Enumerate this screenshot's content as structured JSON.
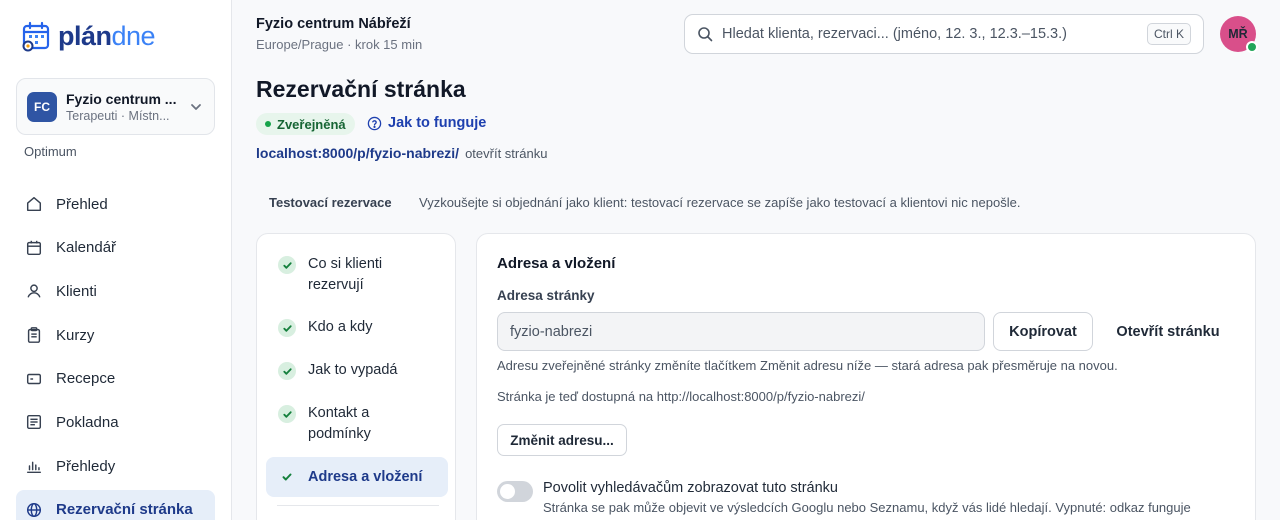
{
  "app": {
    "logo_part1": "plán",
    "logo_part2": "dne"
  },
  "org": {
    "initials": "FC",
    "name": "Fyzio centrum ...",
    "subtitle": "Terapeuti · Místn..."
  },
  "plan": "Optimum",
  "nav": [
    {
      "label": "Přehled",
      "icon": "home-icon"
    },
    {
      "label": "Kalendář",
      "icon": "calendar-icon"
    },
    {
      "label": "Klienti",
      "icon": "user-icon"
    },
    {
      "label": "Kurzy",
      "icon": "clipboard-icon"
    },
    {
      "label": "Recepce",
      "icon": "card-icon"
    },
    {
      "label": "Pokladna",
      "icon": "register-icon"
    },
    {
      "label": "Přehledy",
      "icon": "bar-chart-icon"
    },
    {
      "label": "Rezervační stránka",
      "icon": "globe-icon",
      "active": true
    }
  ],
  "header": {
    "clinic_name": "Fyzio centrum Nábřeží",
    "clinic_sub": "Europe/Prague · krok 15 min",
    "search_placeholder": "Hledat klienta, rezervaci... (jméno, 12. 3., 12.3.–15.3.)",
    "search_shortcut": "Ctrl K",
    "user_initials": "MŘ"
  },
  "page": {
    "title": "Rezervační stránka",
    "status_badge": "Zveřejněná",
    "howto_label": "Jak to funguje",
    "url": "localhost:8000/p/fyzio-nabrezi/",
    "open_page_label": "otevřít stránku",
    "test_label": "Testovací rezervace",
    "test_desc": "Vyzkoušejte si objednání jako klient: testovací rezervace se zapíše jako testovací a klientovi nic nepošle."
  },
  "steps": [
    {
      "label_line1": "Co si klienti",
      "label_line2": "rezervují"
    },
    {
      "label_line1": "Kdo a kdy",
      "label_line2": ""
    },
    {
      "label_line1": "Jak to vypadá",
      "label_line2": ""
    },
    {
      "label_line1": "Kontakt a",
      "label_line2": "podmínky"
    },
    {
      "label_line1": "Adresa a vložení",
      "label_line2": "",
      "active": true
    }
  ],
  "address_card": {
    "title": "Adresa a vložení",
    "field_label": "Adresa stránky",
    "field_value": "fyzio-nabrezi",
    "copy_label": "Kopírovat",
    "open_label": "Otevřít stránku",
    "help_text": "Adresu zveřejněné stránky změníte tlačítkem Změnit adresu níže — stará adresa pak přesměruje na novou.",
    "available_text": "Stránka je teď dostupná na http://localhost:8000/p/fyzio-nabrezi/",
    "change_label": "Změnit adresu...",
    "toggle_label": "Povolit vyhledávačům zobrazovat tuto stránku",
    "toggle_desc": "Stránka se pak může objevit ve výsledcích Googlu nebo Seznamu, když vás lidé hledají. Vypnuté: odkaz funguje",
    "toggle_on": false
  },
  "colors": {
    "brand_dark": "#1e3a8a",
    "brand_light": "#3b82f6",
    "active_bg": "#e6eef9",
    "success": "#16a34a",
    "avatar": "#d94f8a"
  }
}
